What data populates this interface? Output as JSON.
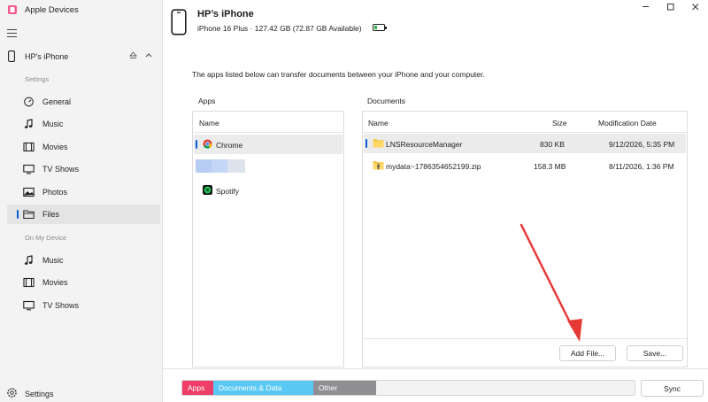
{
  "window": {
    "app_title": "Apple Devices",
    "controls": [
      "minimize",
      "maximize",
      "close"
    ]
  },
  "sidebar": {
    "device_name": "HP's iPhone",
    "settings_section_label": "Settings",
    "settings_items": [
      {
        "label": "General",
        "icon": "general-icon"
      },
      {
        "label": "Music",
        "icon": "music-icon"
      },
      {
        "label": "Movies",
        "icon": "film-icon"
      },
      {
        "label": "TV Shows",
        "icon": "tv-icon"
      },
      {
        "label": "Photos",
        "icon": "photo-icon"
      },
      {
        "label": "Files",
        "icon": "folder-icon",
        "active": true
      }
    ],
    "on_device_section_label": "On My Device",
    "on_device_items": [
      {
        "label": "Music",
        "icon": "music-icon"
      },
      {
        "label": "Movies",
        "icon": "film-icon"
      },
      {
        "label": "TV Shows",
        "icon": "tv-icon"
      }
    ],
    "settings_label": "Settings"
  },
  "header": {
    "device_name": "HP’s iPhone",
    "device_info": "iPhone 16 Plus · 127.42 GB (72.87 GB Available)",
    "battery_level": 0.3,
    "battery_color": "#2fb34a"
  },
  "main": {
    "intro_text": "The apps listed below can transfer documents between your iPhone and your computer.",
    "apps_title": "Apps",
    "apps_column": "Name",
    "apps": [
      {
        "name": "Chrome",
        "icon": "chrome-icon",
        "selected": true
      },
      {
        "name": "",
        "icon": "placeholder"
      },
      {
        "name": "Spotify",
        "icon": "spotify-icon"
      }
    ],
    "docs_title": "Documents",
    "docs_columns": {
      "name": "Name",
      "size": "Size",
      "date": "Modification Date"
    },
    "documents": [
      {
        "name": "LNSResourceManager",
        "size": "830 KB",
        "date": "9/12/2026, 5:35 PM",
        "icon": "folder-icon",
        "selected": true
      },
      {
        "name": "mydata~1786354652199.zip",
        "size": "158.3 MB",
        "date": "8/11/2026, 1:36 PM",
        "icon": "zip-folder-icon"
      }
    ],
    "add_file_label": "Add File...",
    "save_label": "Save..."
  },
  "storage": {
    "segments": [
      {
        "label": "Apps",
        "color": "#ee3d66"
      },
      {
        "label": "Documents & Data",
        "color": "#5ac8f5"
      },
      {
        "label": "Other",
        "color": "#8e8e93"
      }
    ],
    "sync_label": "Sync"
  },
  "annotation": {
    "arrow_color": "#e53935"
  }
}
